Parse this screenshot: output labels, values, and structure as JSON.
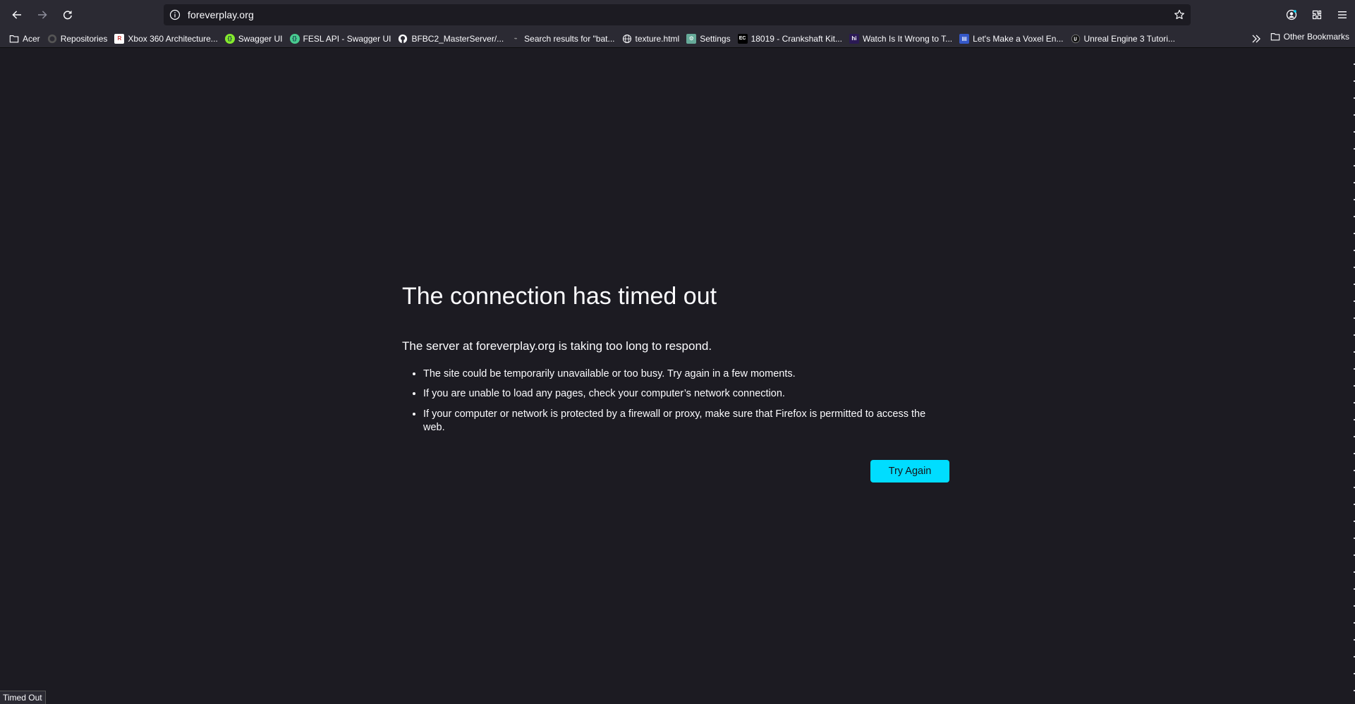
{
  "toolbar": {
    "url": "foreverplay.org"
  },
  "bookmarks": {
    "items": [
      {
        "label": "Acer",
        "icon": "folder-icon"
      },
      {
        "label": "Repositories",
        "icon": "github-icon"
      },
      {
        "label": "Xbox 360 Architecture...",
        "icon": "site-favicon"
      },
      {
        "label": "Swagger UI",
        "icon": "swagger-icon"
      },
      {
        "label": "FESL API - Swagger UI",
        "icon": "swagger-icon"
      },
      {
        "label": "BFBC2_MasterServer/...",
        "icon": "github-icon"
      },
      {
        "label": "Search results for \"bat...",
        "icon": "search-favicon"
      },
      {
        "label": "texture.html",
        "icon": "globe-icon"
      },
      {
        "label": "Settings",
        "icon": "settings-favicon"
      },
      {
        "label": "18019 - Crankshaft Kit...",
        "icon": "ec-favicon"
      },
      {
        "label": "Watch Is It Wrong to T...",
        "icon": "hi-favicon"
      },
      {
        "label": "Let's Make a Voxel En...",
        "icon": "site-favicon"
      },
      {
        "label": "Unreal Engine 3 Tutori...",
        "icon": "unreal-icon"
      }
    ],
    "other": "Other Bookmarks"
  },
  "error": {
    "title": "The connection has timed out",
    "description": "The server at foreverplay.org is taking too long to respond.",
    "items": [
      "The site could be temporarily unavailable or too busy. Try again in a few moments.",
      "If you are unable to load any pages, check your computer’s network connection.",
      "If your computer or network is protected by a firewall or proxy, make sure that Firefox is permitted to access the web."
    ],
    "button": "Try Again"
  },
  "status": "Timed Out",
  "colors": {
    "page_bg": "#1c1b22",
    "toolbar_bg": "#2b2a33",
    "accent": "#00ddff"
  }
}
